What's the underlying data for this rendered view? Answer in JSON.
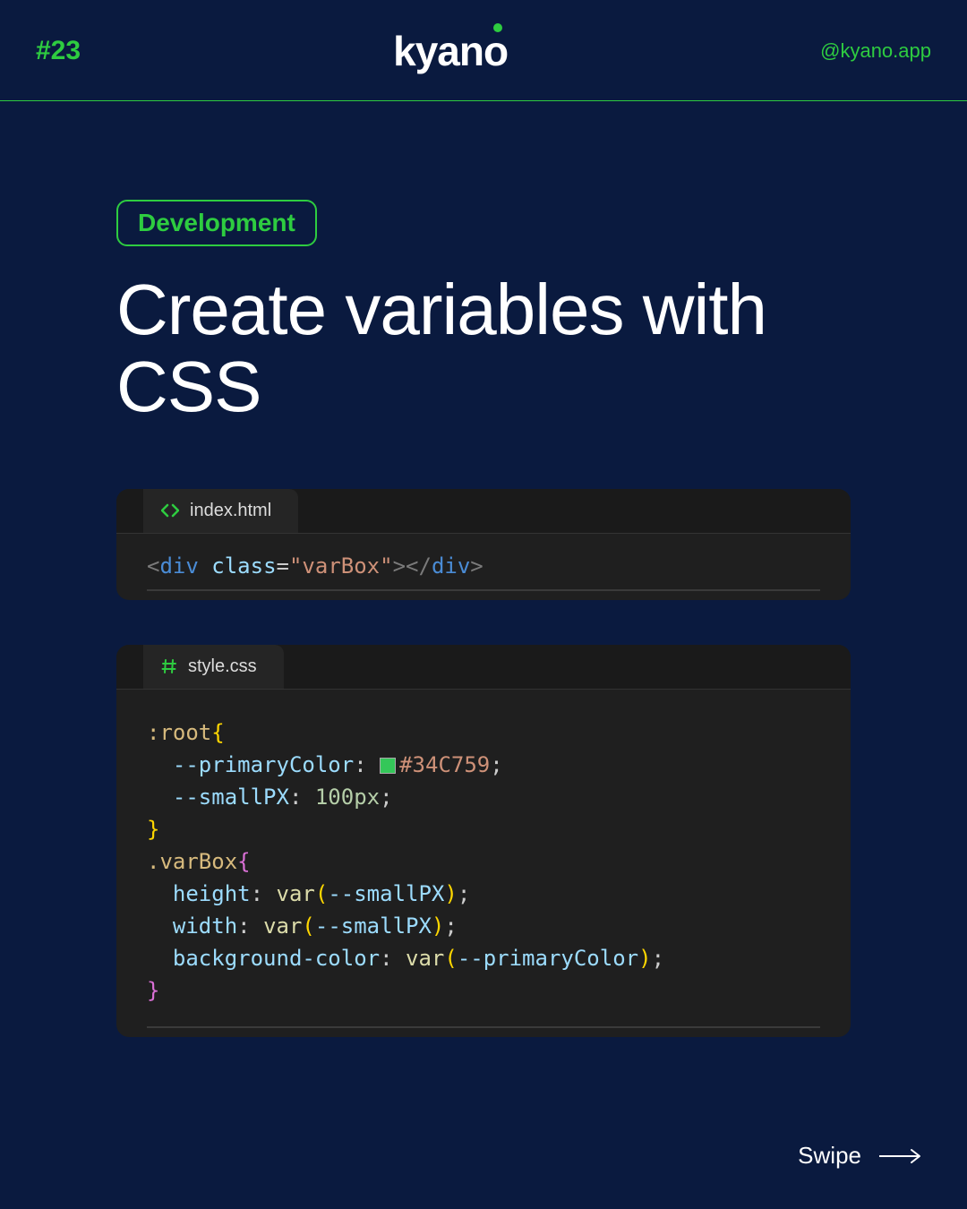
{
  "header": {
    "tick": "#23",
    "logo_text": "kyan",
    "logo_suffix": "o",
    "handle": "@kyano.app"
  },
  "badge": "Development",
  "title": "Create variables with CSS",
  "blocks": {
    "html": {
      "filename": "index.html",
      "tokens": {
        "lt1": "<",
        "tn": "div",
        "sp": " ",
        "attr": "class",
        "eq": "=",
        "q1": "\"",
        "str": "varBox",
        "q2": "\"",
        "gt1": ">",
        "lt2": "</",
        "tn2": "div",
        "gt2": ">"
      }
    },
    "css": {
      "filename": "style.css",
      "swatch_color": "#34C759",
      "tokens": {
        "sel1": ":root",
        "ob1": "{",
        "p1": "--primaryColor",
        "c1": ":",
        "sw": "■",
        "hex": "#34C759",
        "sc1": ";",
        "p2": "--smallPX",
        "c2": ":",
        "v2a": "100",
        "v2b": "px",
        "sc2": ";",
        "cb1": "}",
        "sel2": ".varBox",
        "ob2": "{",
        "p3": "height",
        "c3": ":",
        "f3": "var",
        "op3": "(",
        "a3": "--smallPX",
        "cp3": ")",
        "sc3": ";",
        "p4": "width",
        "c4": ":",
        "f4": "var",
        "op4": "(",
        "a4": "--smallPX",
        "cp4": ")",
        "sc4": ";",
        "p5": "background-color",
        "c5": ":",
        "f5": "var",
        "op5": "(",
        "a5": "--primaryColor",
        "cp5": ")",
        "sc5": ";",
        "cb2": "}"
      }
    }
  },
  "footer": {
    "swipe": "Swipe"
  }
}
